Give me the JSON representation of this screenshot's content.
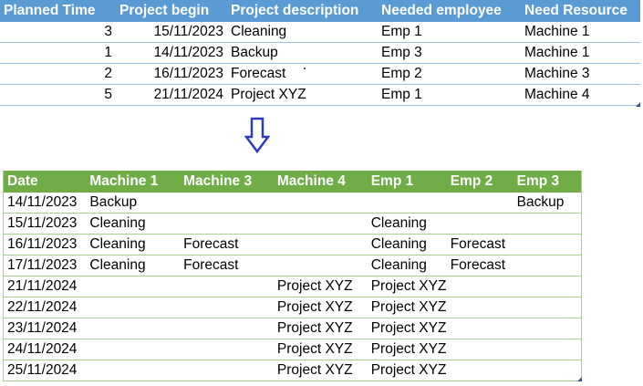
{
  "source_table": {
    "headers": [
      "Planned Time",
      "Project begin",
      "Project description",
      "Needed employee",
      "Need Resource"
    ],
    "rows": [
      [
        "3",
        "15/11/2023",
        "Cleaning",
        "Emp 1",
        "Machine 1"
      ],
      [
        "1",
        "14/11/2023",
        "Backup",
        "Emp 3",
        "Machine 1"
      ],
      [
        "2",
        "16/11/2023",
        "Forecast",
        "Emp 2",
        "Machine 3"
      ],
      [
        "5",
        "21/11/2024",
        "Project XYZ",
        "Emp 1",
        "Machine 4"
      ]
    ],
    "header_color": "#5b9bd5",
    "row_line_color": "#9bc2e6"
  },
  "arrow": {
    "icon": "down-arrow-icon",
    "color": "#2e3bbf"
  },
  "result_table": {
    "headers": [
      "Date",
      "Machine 1",
      "Machine 3",
      "Machine 4",
      "Emp 1",
      "Emp 2",
      "Emp 3"
    ],
    "rows": [
      [
        "14/11/2023",
        "Backup",
        "",
        "",
        "",
        "",
        "Backup"
      ],
      [
        "15/11/2023",
        "Cleaning",
        "",
        "",
        "Cleaning",
        "",
        ""
      ],
      [
        "16/11/2023",
        "Cleaning",
        "Forecast",
        "",
        "Cleaning",
        "Forecast",
        ""
      ],
      [
        "17/11/2023",
        "Cleaning",
        "Forecast",
        "",
        "Cleaning",
        "Forecast",
        ""
      ],
      [
        "21/11/2024",
        "",
        "",
        "Project XYZ",
        "Project XYZ",
        "",
        ""
      ],
      [
        "22/11/2024",
        "",
        "",
        "Project XYZ",
        "Project XYZ",
        "",
        ""
      ],
      [
        "23/11/2024",
        "",
        "",
        "Project XYZ",
        "Project XYZ",
        "",
        ""
      ],
      [
        "24/11/2024",
        "",
        "",
        "Project XYZ",
        "Project XYZ",
        "",
        ""
      ],
      [
        "25/11/2024",
        "",
        "",
        "Project XYZ",
        "Project XYZ",
        "",
        ""
      ]
    ],
    "header_color": "#70ad47",
    "row_line_color": "#a9d08e"
  }
}
